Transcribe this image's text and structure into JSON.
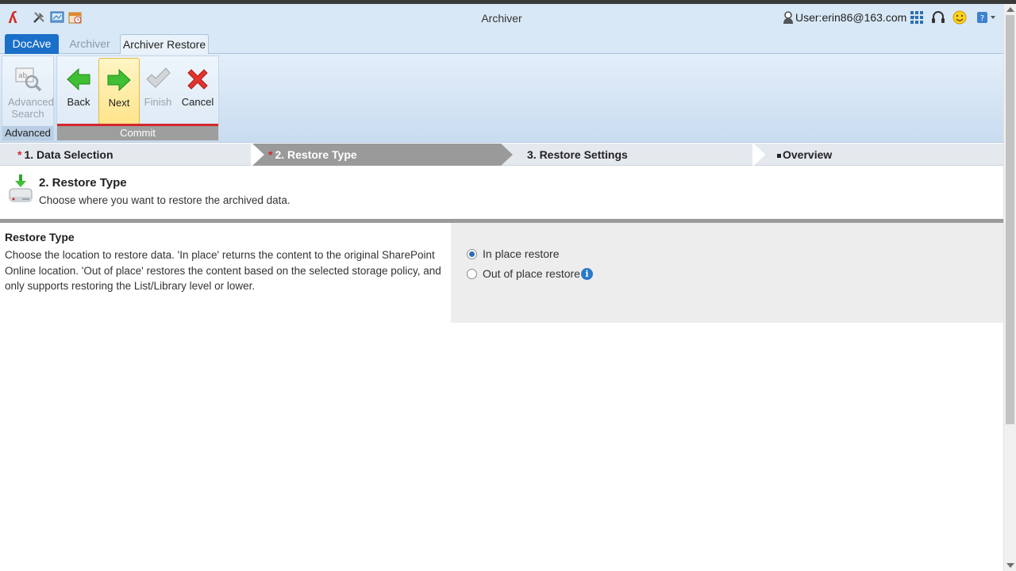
{
  "window": {
    "title": "Archiver"
  },
  "user": {
    "label": "User:erin86@163.com"
  },
  "tabs": [
    {
      "label": "DocAve"
    },
    {
      "label": "Archiver"
    },
    {
      "label": "Archiver Restore"
    }
  ],
  "ribbon": {
    "advanced_group": {
      "label": "Advanced",
      "advanced_search": {
        "line1": "Advanced",
        "line2": "Search"
      }
    },
    "commit_group": {
      "label": "Commit",
      "back": "Back",
      "next": "Next",
      "finish": "Finish",
      "cancel": "Cancel"
    }
  },
  "steps": [
    {
      "label": "1. Data Selection",
      "required_mark": "*"
    },
    {
      "label": "2. Restore Type",
      "required_mark": "*"
    },
    {
      "label": "3. Restore Settings"
    },
    {
      "label": "Overview"
    }
  ],
  "page_header": {
    "title": "2. Restore Type",
    "description": "Choose where you want to restore the archived data."
  },
  "section": {
    "title": "Restore Type",
    "description": "Choose the location to restore data. 'In place' returns the content to the original SharePoint Online location. 'Out of place' restores the content based on the selected storage policy, and only supports restoring the List/Library level or lower.",
    "options": [
      {
        "label": "In place restore",
        "selected": true
      },
      {
        "label": "Out of place restore",
        "selected": false
      }
    ]
  },
  "colors": {
    "accent_blue": "#1a6fc9",
    "commit_red": "#d2282e",
    "active_step": "#9a9a9a"
  }
}
